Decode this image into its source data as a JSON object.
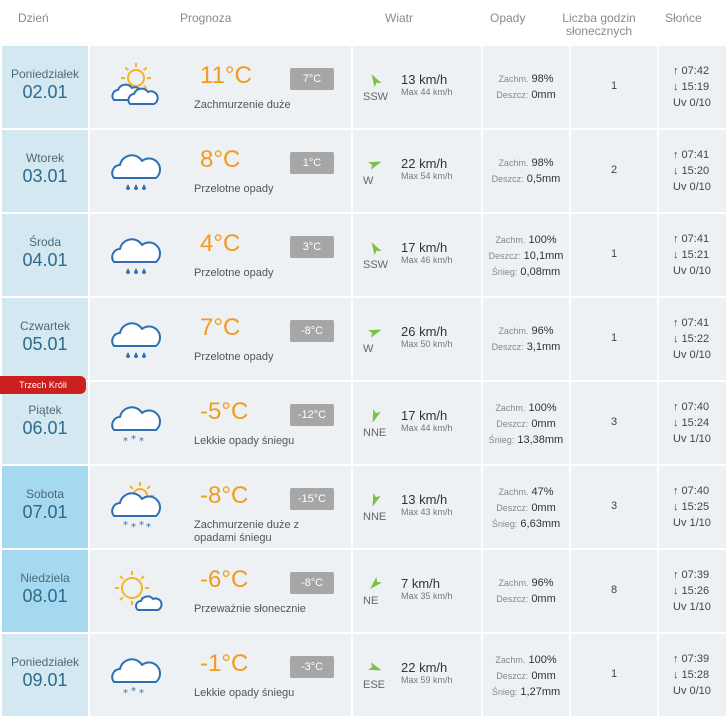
{
  "header": {
    "day": "Dzień",
    "forecast": "Prognoza",
    "wind": "Wiatr",
    "precip": "Opady",
    "sunhours_l1": "Liczba godzin",
    "sunhours_l2": "słonecznych",
    "sun": "Słońce"
  },
  "holiday_badge": "Trzech Króli",
  "labels": {
    "max_prefix": "Max"
  },
  "rows": [
    {
      "day": "Poniedziałek",
      "date": "02.01",
      "weekend": false,
      "icon": "partly-cloudy-icon",
      "temp": "11°C",
      "night": "7°C",
      "desc": "Zachmurzenie duże",
      "wind_dir": "SSW",
      "wind_speed": "13 km/h",
      "wind_max": "Max 44 km/h",
      "precip": [
        {
          "label": "Zachm.",
          "value": "98%"
        },
        {
          "label": "Deszcz:",
          "value": "0mm"
        }
      ],
      "sun_hours": "1",
      "sunrise": "↑ 07:42",
      "sunset": "↓ 15:19",
      "uv": "Uv 0/10"
    },
    {
      "day": "Wtorek",
      "date": "03.01",
      "weekend": false,
      "icon": "rain-cloud-icon",
      "temp": "8°C",
      "night": "1°C",
      "desc": "Przelotne opady",
      "wind_dir": "W",
      "wind_speed": "22 km/h",
      "wind_max": "Max 54 km/h",
      "precip": [
        {
          "label": "Zachm.",
          "value": "98%"
        },
        {
          "label": "Deszcz:",
          "value": "0,5mm"
        }
      ],
      "sun_hours": "2",
      "sunrise": "↑ 07:41",
      "sunset": "↓ 15:20",
      "uv": "Uv 0/10"
    },
    {
      "day": "Środa",
      "date": "04.01",
      "weekend": false,
      "icon": "rain-cloud-icon",
      "temp": "4°C",
      "night": "3°C",
      "desc": "Przelotne opady",
      "wind_dir": "SSW",
      "wind_speed": "17 km/h",
      "wind_max": "Max 46 km/h",
      "precip": [
        {
          "label": "Zachm.",
          "value": "100%"
        },
        {
          "label": "Deszcz:",
          "value": "10,1mm"
        },
        {
          "label": "Śnieg:",
          "value": "0,08mm"
        }
      ],
      "sun_hours": "1",
      "sunrise": "↑ 07:41",
      "sunset": "↓ 15:21",
      "uv": "Uv 0/10"
    },
    {
      "day": "Czwartek",
      "date": "05.01",
      "weekend": false,
      "icon": "rain-cloud-icon",
      "temp": "7°C",
      "night": "-8°C",
      "desc": "Przelotne opady",
      "wind_dir": "W",
      "wind_speed": "26 km/h",
      "wind_max": "Max 50 km/h",
      "precip": [
        {
          "label": "Zachm.",
          "value": "96%"
        },
        {
          "label": "Deszcz:",
          "value": "3,1mm"
        }
      ],
      "sun_hours": "1",
      "sunrise": "↑ 07:41",
      "sunset": "↓ 15:22",
      "uv": "Uv 0/10"
    },
    {
      "day": "Piątek",
      "date": "06.01",
      "weekend": false,
      "icon": "snow-cloud-icon",
      "temp": "-5°C",
      "night": "-12°C",
      "desc": "Lekkie opady śniegu",
      "wind_dir": "NNE",
      "wind_speed": "17 km/h",
      "wind_max": "Max 44 km/h",
      "precip": [
        {
          "label": "Zachm.",
          "value": "100%"
        },
        {
          "label": "Deszcz:",
          "value": "0mm"
        },
        {
          "label": "Śnieg:",
          "value": "13,38mm"
        }
      ],
      "sun_hours": "3",
      "sunrise": "↑ 07:40",
      "sunset": "↓ 15:24",
      "uv": "Uv 1/10"
    },
    {
      "day": "Sobota",
      "date": "07.01",
      "weekend": true,
      "icon": "sun-snow-cloud-icon",
      "temp": "-8°C",
      "night": "-15°C",
      "desc": "Zachmurzenie duże z opadami śniegu",
      "wind_dir": "NNE",
      "wind_speed": "13 km/h",
      "wind_max": "Max 43 km/h",
      "precip": [
        {
          "label": "Zachm.",
          "value": "47%"
        },
        {
          "label": "Deszcz:",
          "value": "0mm"
        },
        {
          "label": "Śnieg:",
          "value": "6,63mm"
        }
      ],
      "sun_hours": "3",
      "sunrise": "↑ 07:40",
      "sunset": "↓ 15:25",
      "uv": "Uv 1/10"
    },
    {
      "day": "Niedziela",
      "date": "08.01",
      "weekend": true,
      "icon": "mostly-sunny-icon",
      "temp": "-6°C",
      "night": "-8°C",
      "desc": "Przeważnie słonecznie",
      "wind_dir": "NE",
      "wind_speed": "7 km/h",
      "wind_max": "Max 35 km/h",
      "precip": [
        {
          "label": "Zachm.",
          "value": "96%"
        },
        {
          "label": "Deszcz:",
          "value": "0mm"
        }
      ],
      "sun_hours": "8",
      "sunrise": "↑ 07:39",
      "sunset": "↓ 15:26",
      "uv": "Uv 1/10"
    },
    {
      "day": "Poniedziałek",
      "date": "09.01",
      "weekend": false,
      "icon": "snow-cloud-icon",
      "temp": "-1°C",
      "night": "-3°C",
      "desc": "Lekkie opady śniegu",
      "wind_dir": "ESE",
      "wind_speed": "22 km/h",
      "wind_max": "Max 59 km/h",
      "precip": [
        {
          "label": "Zachm.",
          "value": "100%"
        },
        {
          "label": "Deszcz:",
          "value": "0mm"
        },
        {
          "label": "Śnieg:",
          "value": "1,27mm"
        }
      ],
      "sun_hours": "1",
      "sunrise": "↑ 07:39",
      "sunset": "↓ 15:28",
      "uv": "Uv 0/10"
    }
  ],
  "colors": {
    "temp": "#f39b1d",
    "day_bg": "#d4e8f2",
    "weekend_bg": "#a6d8ef",
    "cell_bg": "#edf1f3",
    "holiday": "#cc1f1f",
    "wind_arrow": "#7cc142",
    "icon_blue": "#2f6fb5",
    "icon_sun": "#f4b423"
  }
}
